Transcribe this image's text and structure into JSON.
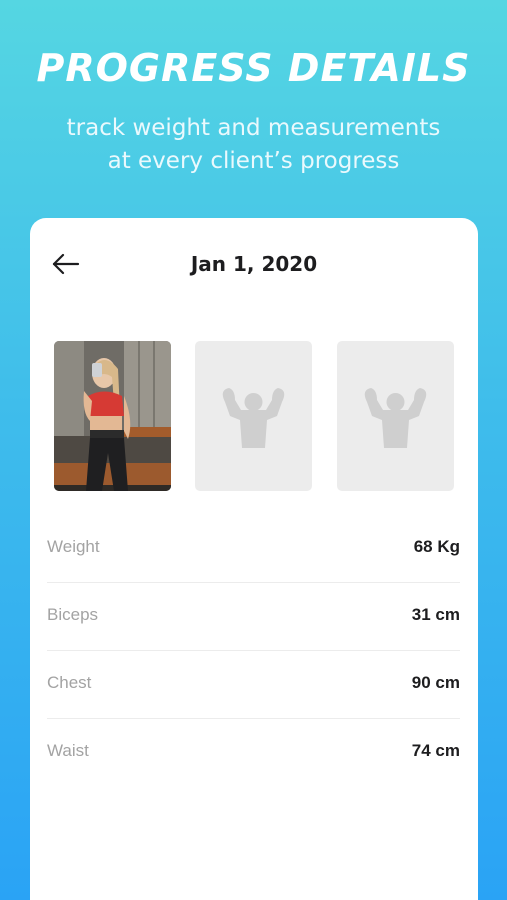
{
  "header": {
    "title": "PROGRESS DETAILS",
    "subtitle_line1": "track weight and measurements",
    "subtitle_line2": "at every client’s progress"
  },
  "card": {
    "date": "Jan 1, 2020",
    "back_icon": "arrow-left-icon",
    "photos": [
      {
        "type": "photo",
        "description_icon": "progress-photo"
      },
      {
        "type": "placeholder",
        "icon": "flexing-body-icon"
      },
      {
        "type": "placeholder",
        "icon": "flexing-body-icon"
      }
    ],
    "metrics": [
      {
        "label": "Weight",
        "value": "68 Kg"
      },
      {
        "label": "Biceps",
        "value": "31 cm"
      },
      {
        "label": "Chest",
        "value": "90 cm"
      },
      {
        "label": "Waist",
        "value": "74 cm"
      }
    ]
  },
  "colors": {
    "gradient_top": "#55d6e2",
    "gradient_bottom": "#2aa3f5",
    "placeholder_bg": "#ececec",
    "label_gray": "#a3a3a3"
  }
}
